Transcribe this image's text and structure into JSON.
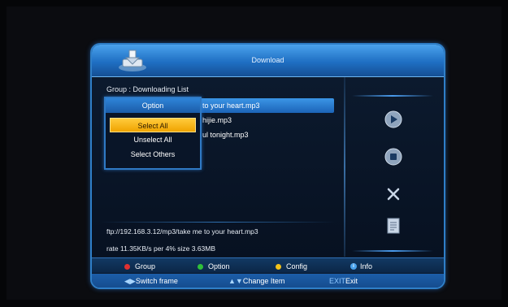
{
  "window": {
    "title": "Download",
    "group_label": "Group : Downloading List"
  },
  "list": {
    "items": [
      {
        "label": "to your heart.mp3",
        "selected": true
      },
      {
        "label": "hijie.mp3",
        "selected": false
      },
      {
        "label": "ul tonight.mp3",
        "selected": false
      }
    ]
  },
  "option_menu": {
    "header": "Option",
    "items": [
      "Select All",
      "Unselect All",
      "Select Others"
    ],
    "active_index": 0
  },
  "status": {
    "ftp_path": "ftp://192.168.3.12/mp3/take me to your heart.mp3",
    "rate_line": "rate 11.35KB/s  per 4%  size 3.63MB"
  },
  "controls": {
    "icons": [
      "play-icon",
      "stop-icon",
      "delete-icon",
      "notes-icon"
    ]
  },
  "legend": {
    "group": {
      "label": "Group",
      "color": "#e03030"
    },
    "option": {
      "label": "Option",
      "color": "#2fbf3a"
    },
    "config": {
      "label": "Config",
      "color": "#f2c21a"
    },
    "info": {
      "label": "Info",
      "color": "#4aa2ec"
    }
  },
  "nav": {
    "switch_glyph": "◀▶",
    "switch_label": "Switch frame",
    "change_glyph": "▲▼",
    "change_label": "Change Item",
    "exit_key": "EXIT",
    "exit_label": "Exit"
  },
  "colors": {
    "accent": "#2f7fc8",
    "highlight": "#f0a300",
    "selection": "#3b95e6"
  }
}
